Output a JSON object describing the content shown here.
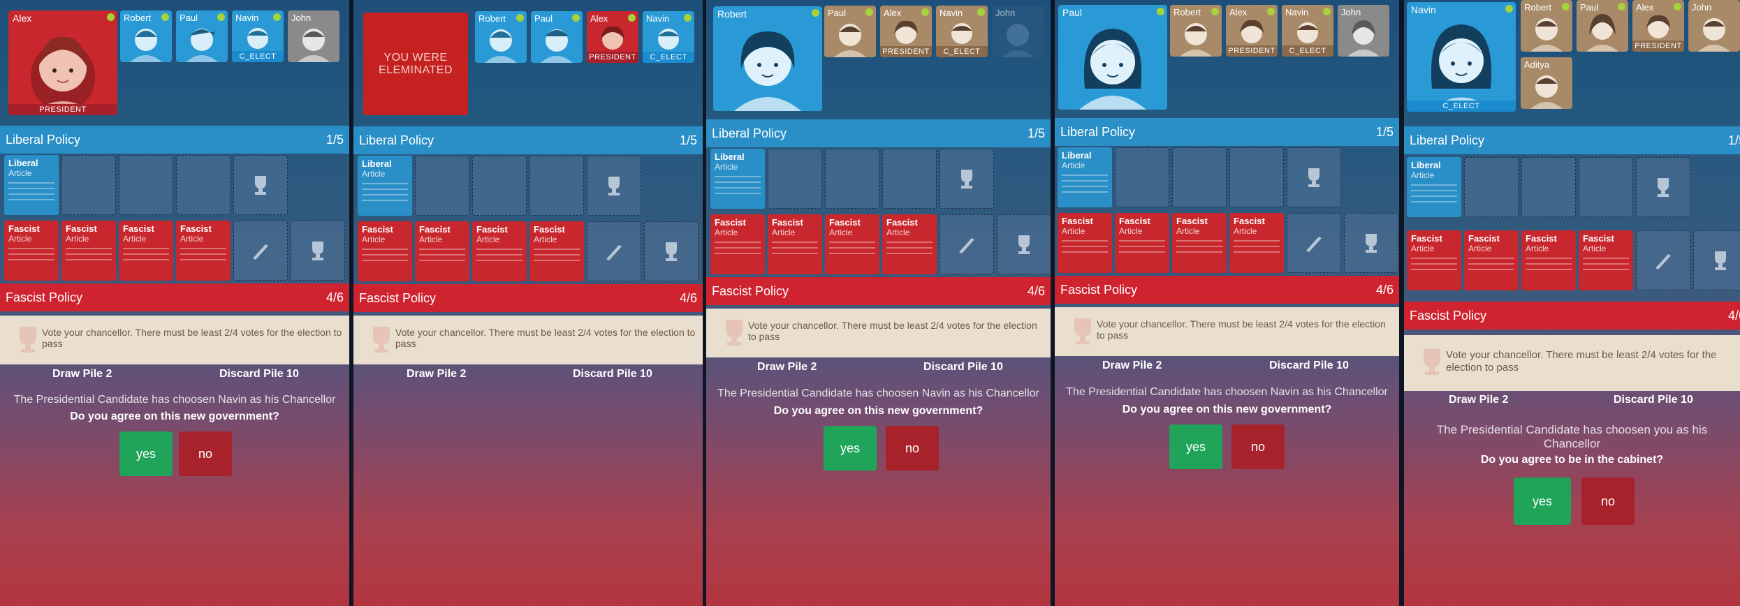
{
  "labels": {
    "liberal_policy": "Liberal Policy",
    "fascist_policy": "Fascist Policy",
    "liberal_count": "1/5",
    "fascist_count": "4/6",
    "liberal_card_title": "Liberal",
    "fascist_card_title": "Fascist",
    "card_sub": "Article",
    "vote_text": "Vote your chancellor. There must be least 2/4 votes for the election to pass",
    "draw_pile": "Draw Pile 2",
    "discard_pile": "Discard Pile 10",
    "eliminated": "YOU WERE ELEMINATED",
    "yes": "yes",
    "no": "no",
    "role_president": "PRESIDENT",
    "role_c_elect": "C_ELECT"
  },
  "panels": [
    {
      "big": "Alex",
      "small": [
        "Robert",
        "Paul",
        "Navin",
        "John"
      ],
      "message": "The Presidential Candidate has choosen Navin as his Chancellor",
      "question": "Do you agree on this new government?"
    },
    {
      "small": [
        "Robert",
        "Paul",
        "Alex",
        "Navin"
      ]
    },
    {
      "big": "Robert",
      "small": [
        "Paul",
        "Alex",
        "Navin",
        "John"
      ],
      "message": "The Presidential Candidate has choosen Navin as his Chancellor",
      "question": "Do you agree on this new government?"
    },
    {
      "big": "Paul",
      "small": [
        "Robert",
        "Alex",
        "Navin",
        "John"
      ],
      "message": "The Presidential Candidate has choosen Navin as his Chancellor",
      "question": "Do you agree on this new government?"
    },
    {
      "big": "Navin",
      "small": [
        "Robert",
        "Paul",
        "Alex",
        "John",
        "Aditya"
      ],
      "message": "The Presidential Candidate has choosen you as his Chancellor",
      "question": "Do you agree to be in the cabinet?"
    }
  ],
  "colors": {
    "liberal": "#2a8fc7",
    "fascist": "#cf2430",
    "yes": "#1fa45a",
    "no": "#a7222b",
    "online_dot": "#a6d23a"
  }
}
